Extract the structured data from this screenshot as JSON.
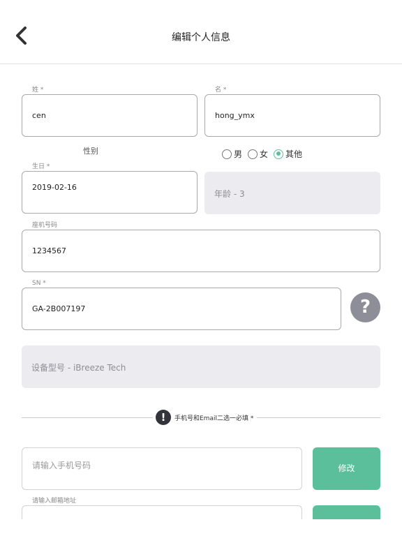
{
  "header": {
    "title": "编辑个人信息",
    "back_icon": "chevron-left-icon"
  },
  "form": {
    "last_name": {
      "label": "姓 *",
      "value": "cen"
    },
    "first_name": {
      "label": "名 *",
      "value": "hong_ymx"
    },
    "gender": {
      "caption": "性别",
      "options": [
        "男",
        "女",
        "其他"
      ],
      "selected": "其他"
    },
    "birthday": {
      "label": "生日 *",
      "value": "2019-02-16"
    },
    "age": {
      "text": "年龄 - 3"
    },
    "landline": {
      "label": "座机号码",
      "value": "1234567"
    },
    "sn": {
      "label": "SN *",
      "value": "GA-2B007197",
      "help_icon": "question-mark-icon",
      "help_glyph": "?"
    },
    "device_model": {
      "text": "设备型号 - iBreeze Tech"
    },
    "contact_notice": {
      "icon": "exclamation-icon",
      "glyph": "!",
      "text": "手机号和Email二选一必填 *"
    },
    "phone": {
      "placeholder": "请输入手机号码",
      "button_label": "修改"
    },
    "email": {
      "label": "请输入邮箱地址"
    }
  },
  "colors": {
    "accent": "#5cbf9b",
    "readonly_bg": "#ebebf0",
    "help_bg": "#8e8e99"
  }
}
